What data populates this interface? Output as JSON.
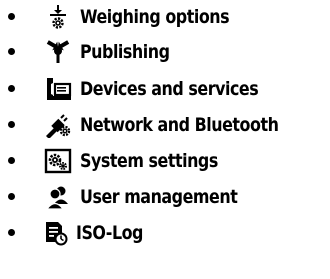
{
  "menu": {
    "items": [
      {
        "label": "Weighing options",
        "icon": "weighing-options-icon"
      },
      {
        "label": "Publishing",
        "icon": "publishing-icon"
      },
      {
        "label": "Devices and services",
        "icon": "devices-services-icon"
      },
      {
        "label": "Network and Bluetooth",
        "icon": "network-bluetooth-icon"
      },
      {
        "label": "System settings",
        "icon": "system-settings-icon"
      },
      {
        "label": "User management",
        "icon": "user-management-icon"
      },
      {
        "label": "ISO-Log",
        "icon": "iso-log-icon"
      }
    ]
  },
  "colors": {
    "text": "#000000",
    "background": "#ffffff"
  }
}
